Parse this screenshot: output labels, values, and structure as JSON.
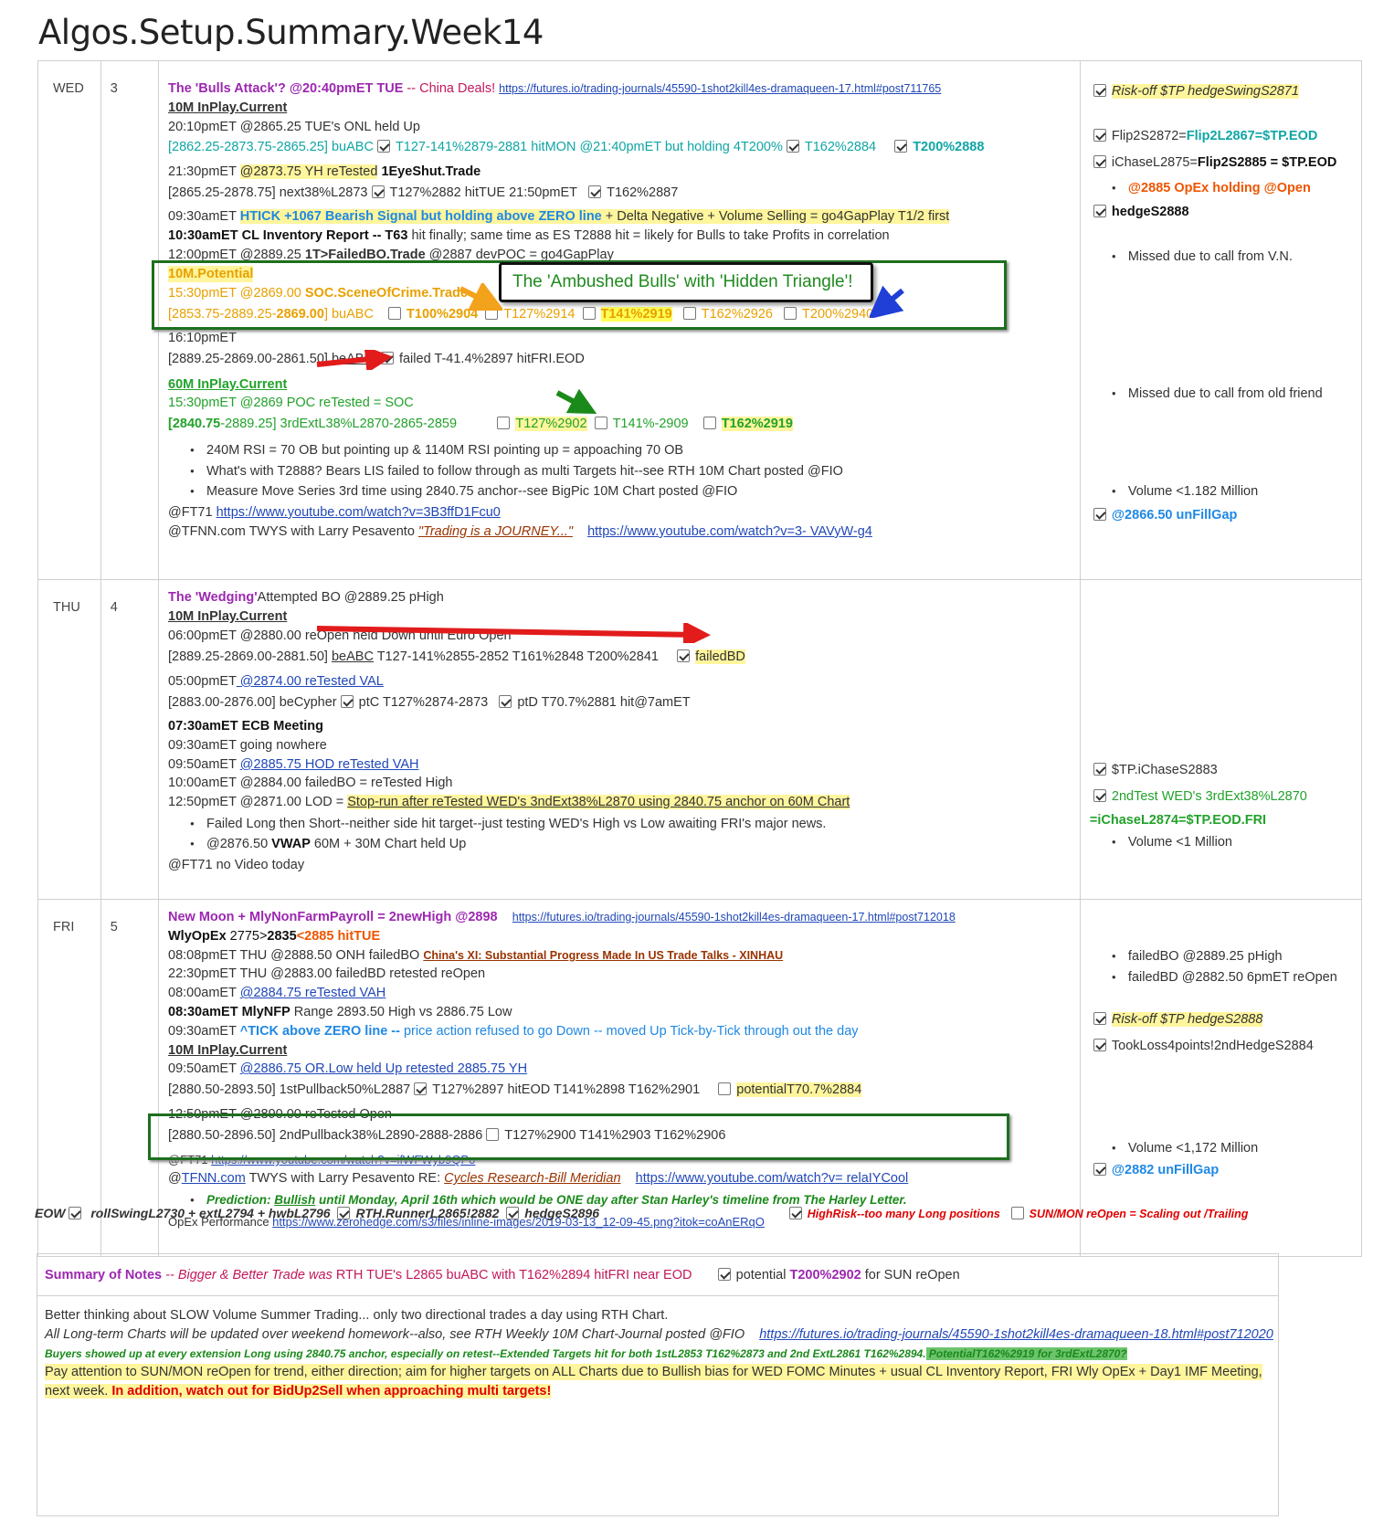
{
  "page_title": "Algos.Setup.Summary.Week14",
  "wed": {
    "day": "WED",
    "num": "3",
    "title_prefix": "The 'Bulls Attack'? @20:40pmET TUE",
    "title_suffix": " -- China Deals! ",
    "title_link": "https://futures.io/trading-journals/45590-1shot2kill4es-dramaqueen-17.html#post711765",
    "inplay_10m": "10M InPlay.Current",
    "l1": "20:10pmET @2865.25 TUE's ONL held Up",
    "l2a": "[2862.25-2873.75-2865.25] buABC",
    "l2b": "T127-141%2879-2881 hitMON @21:40pmET but holding 4T200%",
    "l2c": "T162%2884",
    "l2d": "T200%2888",
    "l3a": "21:30pmET ",
    "l3b": "@2873.75 YH reTested",
    "l3c": " 1EyeShut.Trade",
    "l4a": "[2865.25-2878.75] next38%L2873",
    "l4b": "T127%2882 hitTUE 21:50pmET",
    "l4c": "T162%2887",
    "l5a": "09:30amET ",
    "l5b": "HTICK +1067 Bearish Signal but holding above ZERO line",
    "l5c": "  + Delta Negative + Volume Selling = go4GapPlay T1/2 first",
    "l6a": "10:30amET CL Inventory Report --  T63",
    "l6b": " hit finally; same time as ES T2888 hit = likely for Bulls  to take Profits in correlation",
    "l7a": "12:00pmET @2889.25 ",
    "l7b": "1T>FailedBO.Trade",
    "l7c": " @2887 devPOC = go4GapPlay",
    "pot_title": "10M.Potential",
    "pot1a": "15:30pmET @2869.00 ",
    "pot1b": "SOC.SceneOfCrime.Trade",
    "pot2a": "[2853.75-2889.25-",
    "pot2b": "2869.00",
    "pot2c": "] buABC",
    "pot2d": "T100%2904",
    "pot2e": "T127%2914",
    "pot2f": "T141%2919",
    "pot2g": "T162%2926",
    "pot2h": "T200%2940",
    "callout": "The 'Ambushed Bulls' with 'Hidden Triangle'!",
    "l8": "16:10pmET",
    "l9a": "[2889.25-2869.00-2861.50] ",
    "l9b": "beABC",
    "l9c": "failed T-41.4%2897 hitFRI.EOD",
    "inplay_60m": "60M InPlay.Current",
    "l10": "15:30pmET @2869 POC reTested = SOC",
    "l11a": "[2840.75",
    "l11b": "-2889.25] 3rdExtL38%L2870-2865-2859",
    "l11c": "T127%2902",
    "l11d": "T141%-2909",
    "l11e": "T162%2919",
    "b1": "240M RSI = 70 OB but pointing up & 1140M RSI pointing up = appoaching 70 OB",
    "b2": "What's with T2888? Bears LIS failed to follow through as multi Targets hit--see RTH 10M Chart posted @FIO",
    "b3": "Measure Move Series 3rd time using 2840.75 anchor--see BigPic 10M Chart posted @FIO",
    "ft71": "@FT71  ",
    "ft71_link": "https://www.youtube.com/watch?v=3B3ffD1Fcu0",
    "tfnn": "@TFNN.com TWYS with Larry Pesavento ",
    "tfnn_quote": "\"Trading is a JOURNEY...\"",
    "tfnn_link": "https://www.youtube.com/watch?v=3- VAVyW-g4",
    "side": {
      "s1": "Risk-off $TP hedgeSwingS2871",
      "s2a": "Flip2S2872=",
      "s2b": "Flip2L2867=$TP.EOD",
      "s3a": "iChaseL2875=",
      "s3b": "Flip2S2885",
      "s3c": " = $TP.EOD",
      "s4": "@2885 OpEx holding @Open",
      "s5": "hedgeS2888",
      "s6": "Missed due to call from V.N.",
      "s7": "Missed due to call from old friend",
      "s8": "Volume <1.182 Million",
      "s9": "@2866.50 unFillGap"
    }
  },
  "thu": {
    "day": "THU",
    "num": "4",
    "title_a": "The 'Wedging'",
    "title_b": "Attempted BO @2889.25 pHigh",
    "inplay_10m": "10M InPlay.Current",
    "l1": "06:00pmET @2880.00 reOpen held Down until Euro Open",
    "l2a": "[2889.25-2869.00-2881.50] ",
    "l2b": "beABC",
    "l2c": "    T127-141%2855-2852    T161%2848    T200%2841",
    "l2d": "failedBD",
    "l3a": "05:00pmET",
    "l3b": " @2874.00 reTested VAL",
    "l4a": "[2883.00-2876.00] beCypher",
    "l4b": "ptC T127%2874-2873",
    "l4c": "ptD T70.7%2881 hit@7amET",
    "l5": "07:30amET ECB Meeting",
    "l6": "09:30amET going nowhere",
    "l7a": "09:50amET ",
    "l7b": "@2885.75 HOD reTested VAH ",
    "l8": "10:00amET @2884.00 failedBO =  reTested High",
    "l9a": "12:50pmET @2871.00 LOD = ",
    "l9b": "Stop-run after reTested WED's 3ndExt38%L2870 using 2840.75 anchor on 60M Chart",
    "b1": "Failed Long then Short--neither side hit target--just testing WED's High vs Low awaiting FRI's major news.",
    "b2a": "@2876.50 ",
    "b2b": "VWAP",
    "b2c": " 60M + 30M Chart held Up",
    "ft71": "@FT71  no Video today",
    "side": {
      "s1": "$TP.iChaseS2883",
      "s2": "2ndTest WED's 3rdExt38%L2870",
      "s3": "=iChaseL2874=$TP.EOD.FRI",
      "s4": "Volume <1 Million"
    }
  },
  "fri": {
    "day": "FRI",
    "num": "5",
    "title": "New Moon + MlyNonFarmPayroll = 2newHigh @2898",
    "title_link": "https://futures.io/trading-journals/45590-1shot2kill4es-dramaqueen-17.html#post712018",
    "l1a": "WlyOpEx",
    "l1b": " 2775>",
    "l1c": "2835",
    "l1d": "<2885 hitTUE",
    "l2a": "08:08pmET THU @2888.50 ONH failedBO ",
    "l2b": "China's XI: Substantial Progress Made In US Trade Talks - XINHAU",
    "l3": "22:30pmET THU @2883.00 failedBD retested reOpen",
    "l4a": "08:00amET ",
    "l4b": "@2884.75 reTested VAH",
    "l5a": "08:30amET MlyNFP",
    "l5b": " Range 2893.50 High vs 2886.75 Low",
    "l6a": "09:30amET ",
    "l6b": "^TICK above ZERO line --",
    "l6c": " price action refused to go Down -- moved Up Tick-by-Tick through out the day",
    "inplay_10m": "10M InPlay.Current",
    "l7a": "09:50amET ",
    "l7b": "@2886.75 OR.Low held Up retested 2885.75 YH",
    "l8a": "[2880.50-2893.50] 1stPullback50%L2887",
    "l8b": "T127%2897 hitEOD     T141%2898       T162%2901",
    "l8c": "potentialT70.7%2884",
    "l9": "12:50pmET @2890.00 reTested Open",
    "l10a": "[2880.50-2896.50] 2ndPullback38%L2890-2888-2886",
    "l10b": "T127%2900     T141%2903      T162%2906",
    "ft71": "@FT71     ",
    "ft71_link": "https://www.youtube.com/watch?v=ifWFWyb9QPo",
    "tfnn_a": "@",
    "tfnn_link1": "TFNN.com",
    "tfnn_b": " TWYS with Larry Pesavento RE:  ",
    "tfnn_quote": "Cycles Research-Bill Meridian",
    "tfnn_link2": "https://www.youtube.com/watch?v= relaIYCool",
    "pred_a": "Prediction:  ",
    "pred_b": "Bullish",
    "pred_c": " until Monday, April 16th which would be ONE day after Stan Harley's timeline from The Harley Letter.",
    "opex_a": "OpEx Performance ",
    "opex_link": "https://www.zerohedge.com/s3/files/inline-images/2019-03-13_12-09-45.png?itok=coAnERqO",
    "side": {
      "s1": "failedBO @2889.25 pHigh",
      "s2": "failedBD @2882.50 6pmET reOpen",
      "s3": "Risk-off $TP hedgeS2888",
      "s4": "TookLoss4points!2ndHedgeS2884",
      "s5": "Volume <1,172 Million",
      "s6": "@2882 unFillGap"
    }
  },
  "eow": {
    "label": "EOW",
    "i1": "rollSwingL2730",
    "i2": "  + extL2794 + hwbL2796",
    "i3": "RTH.RunnerL2865!2882",
    "i4": "hedgeS2896",
    "i5": "HighRisk--too many Long positions",
    "i6": "SUN/MON reOpen = Scaling out /Trailing"
  },
  "summary": {
    "title": "Summary of Notes",
    "head_a": "  -- Bigger & Better Trade was ",
    "head_b": " RTH TUE's L2865 buABC  with T162%2894 hitFRI near EOD",
    "head_c": "potential ",
    "head_d": "T200%2902",
    "head_e": " for SUN reOpen",
    "r1": "Better thinking about SLOW Volume Summer Trading... only two directional trades a day using RTH Chart.",
    "r2": "All Long-term Charts will be updated over weekend homework--also, see RTH Weekly 10M Chart-Journal posted @FIO",
    "r2_link": "https://futures.io/trading-journals/45590-1shot2kill4es-dramaqueen-18.html#post712020",
    "r3a": "Buyers showed up at every extension Long using 2840.75 anchor, especially on retest--Extended Targets hit for both 1stL2853 T162%2873 and 2nd ExtL2861 T162%2894.",
    "r3b": " PotentialT162%2919 for 3rdExtL2870?",
    "r4": "Pay attention to SUN/MON reOpen for trend, either direction; aim for higher targets on ALL Charts due to Bullish bias for WED FOMC Minutes + usual CL Inventory Report, FRI Wly OpEx + Day1 IMF Meeting,",
    "r5a": "next week.",
    "r5b": "  In addition, watch out for BidUp2Sell when approaching multi targets!"
  },
  "colors": {
    "purple": "#9c27b0",
    "teal": "#10a5a5",
    "orange": "#e8a000",
    "green": "#22a22a",
    "blue": "#1e88e5",
    "red": "#e00000",
    "highlight": "#fff59d",
    "box_border": "#1e6f1e"
  }
}
